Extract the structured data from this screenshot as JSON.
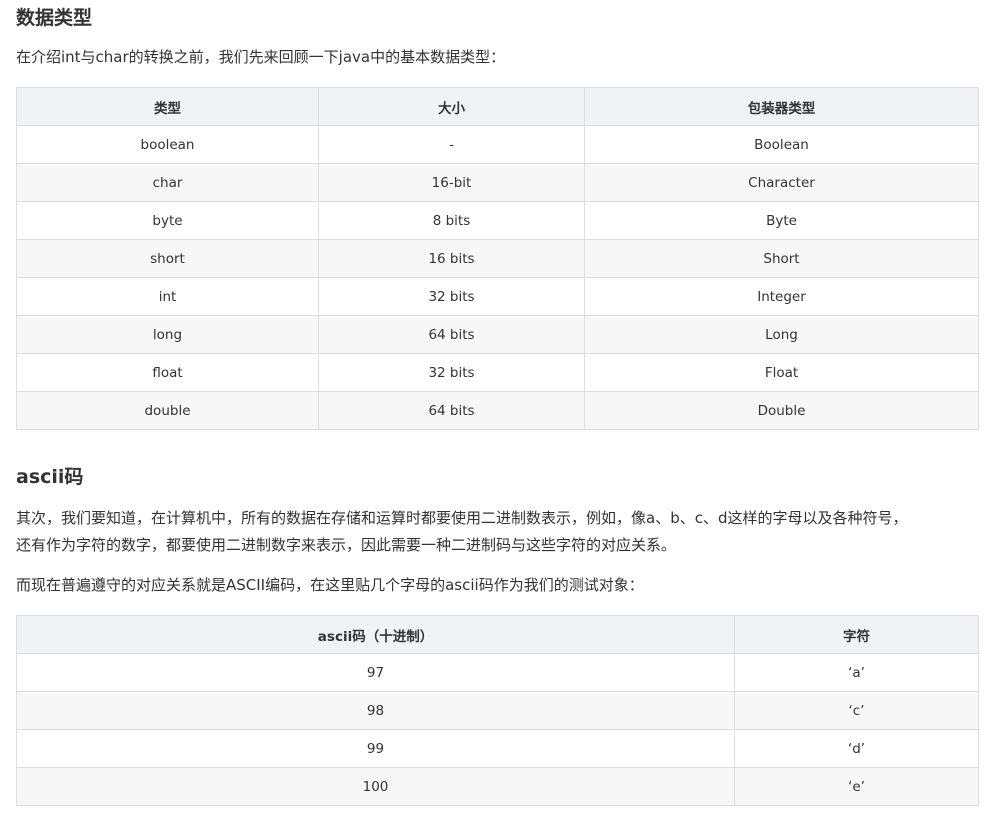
{
  "section1": {
    "heading": "数据类型",
    "intro": "在介绍int与char的转换之前，我们先来回顾一下java中的基本数据类型：",
    "table": {
      "headers": [
        "类型",
        "大小",
        "包装器类型"
      ],
      "rows": [
        [
          "boolean",
          "-",
          "Boolean"
        ],
        [
          "char",
          "16-bit",
          "Character"
        ],
        [
          "byte",
          "8 bits",
          "Byte"
        ],
        [
          "short",
          "16 bits",
          "Short"
        ],
        [
          "int",
          "32 bits",
          "Integer"
        ],
        [
          "long",
          "64 bits",
          "Long"
        ],
        [
          "float",
          "32 bits",
          "Float"
        ],
        [
          "double",
          "64 bits",
          "Double"
        ]
      ]
    }
  },
  "section2": {
    "heading": "ascii码",
    "para1_line1": "其次，我们要知道，在计算机中，所有的数据在存储和运算时都要使用二进制数表示，例如，像a、b、c、d这样的字母以及各种符号，",
    "para1_line2": "还有作为字符的数字，都要使用二进制数字来表示，因此需要一种二进制码与这些字符的对应关系。",
    "para2": "而现在普遍遵守的对应关系就是ASCII编码，在这里贴几个字母的ascii码作为我们的测试对象：",
    "table": {
      "headers": [
        "ascii码（十进制）",
        "字符"
      ],
      "rows": [
        [
          "97",
          "‘a’"
        ],
        [
          "98",
          "‘c’"
        ],
        [
          "99",
          "‘d’"
        ],
        [
          "100",
          "‘e’"
        ]
      ]
    }
  }
}
